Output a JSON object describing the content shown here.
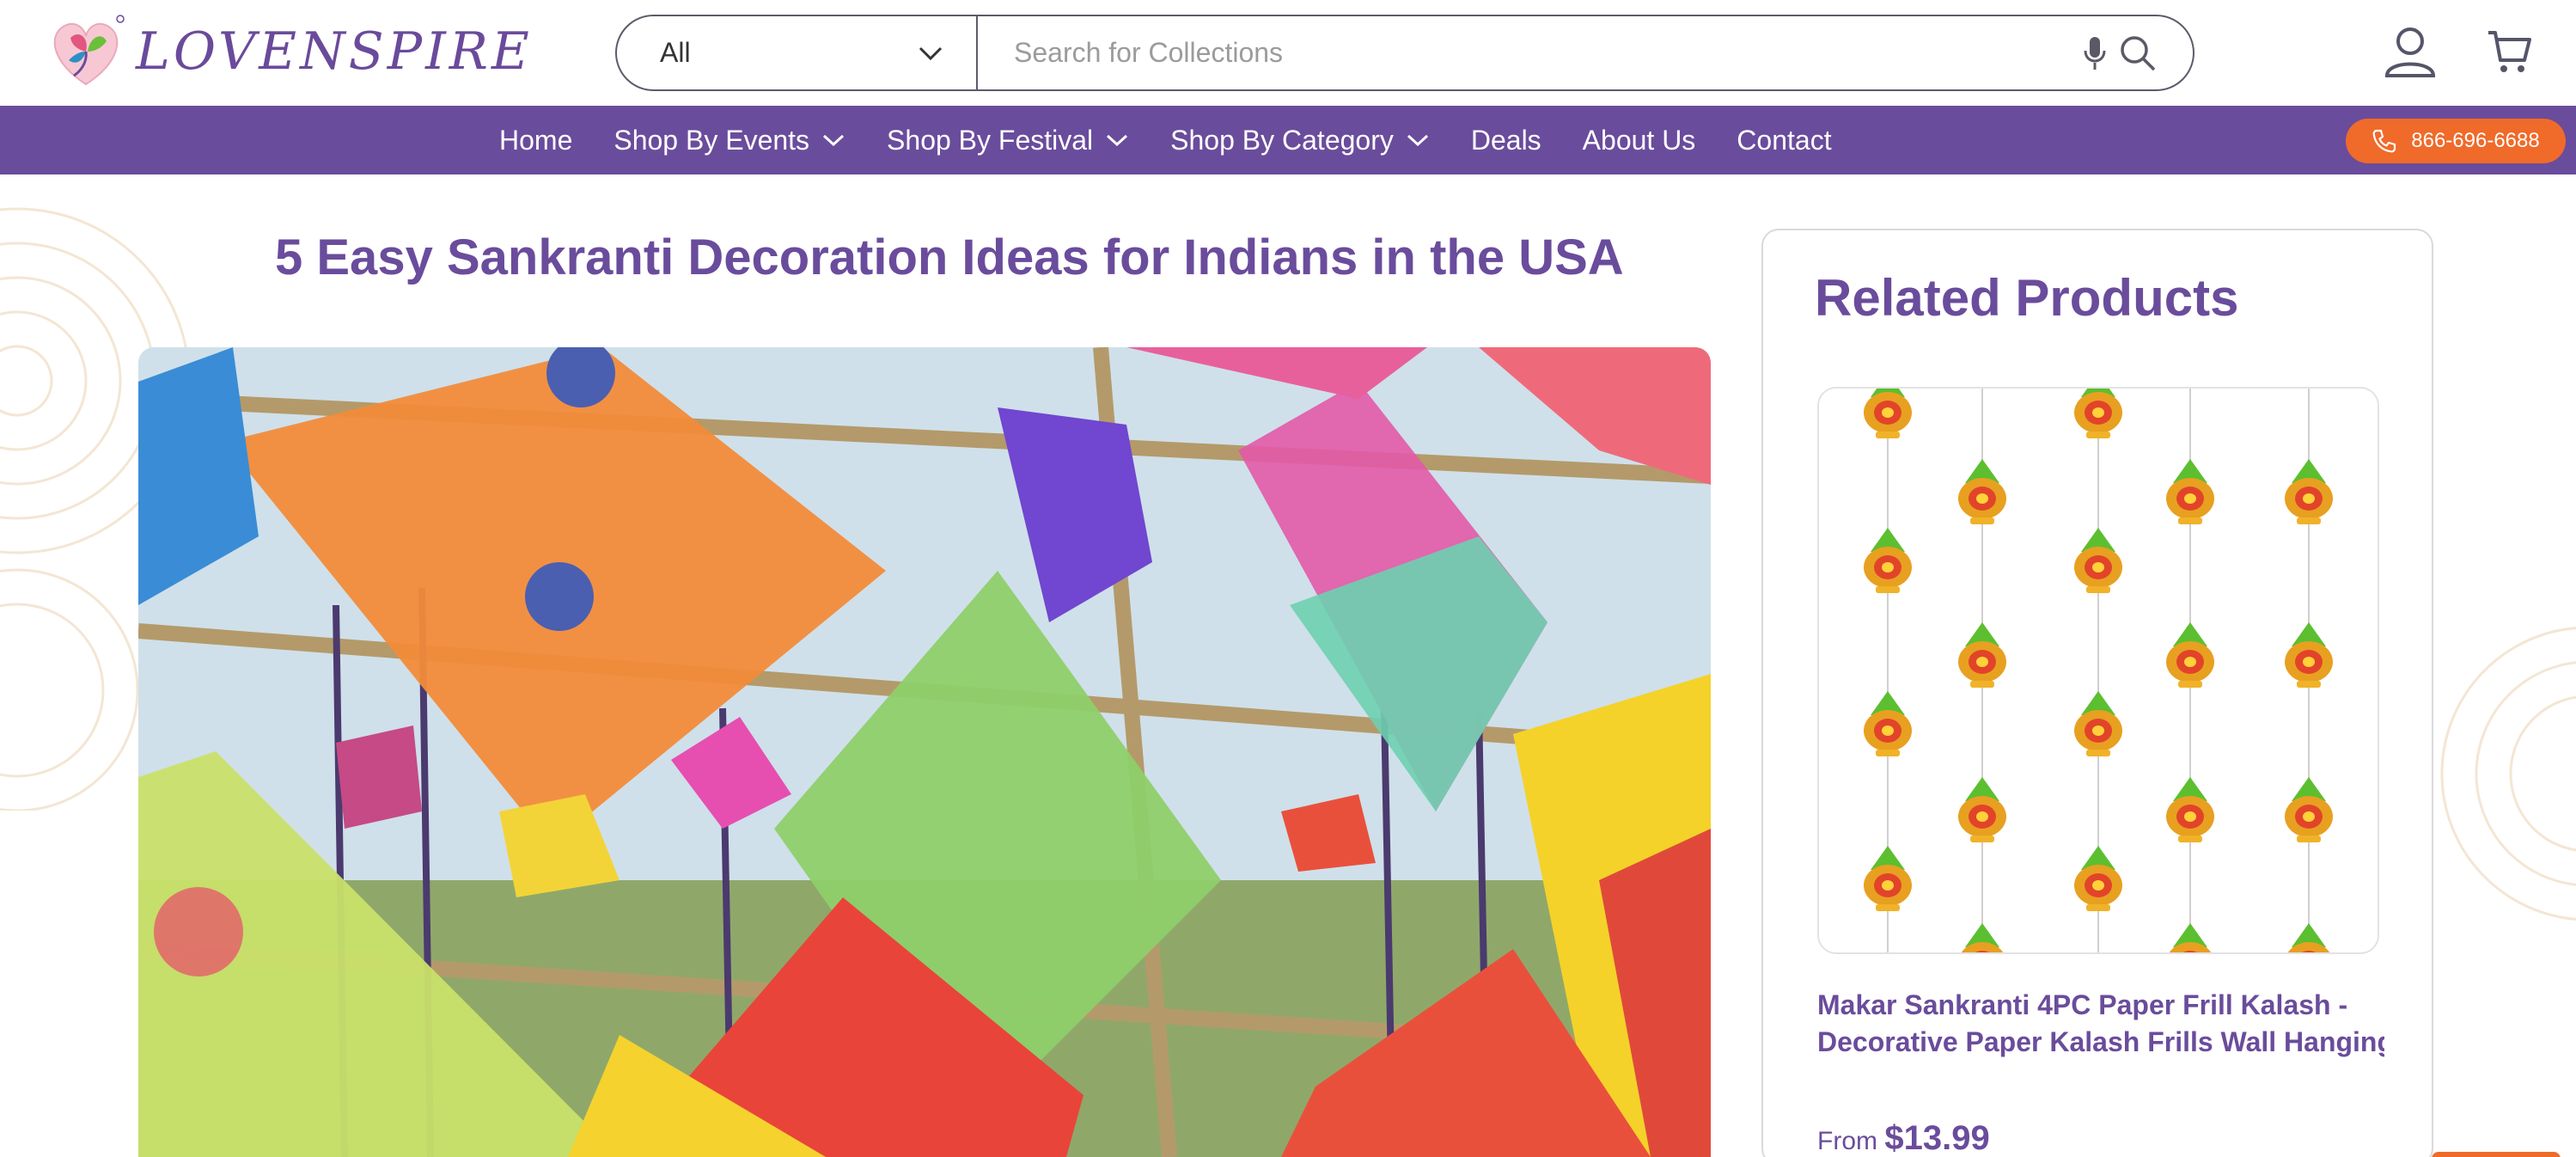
{
  "brand": {
    "name": "LOVENSPIRE",
    "color": "#6a4c9c",
    "accent": "#f06a2a"
  },
  "search": {
    "category": "All",
    "placeholder": "Search for Collections"
  },
  "header_icons": [
    "microphone-icon",
    "search-icon",
    "user-icon",
    "cart-icon"
  ],
  "nav": {
    "items": [
      {
        "label": "Home",
        "dropdown": false
      },
      {
        "label": "Shop By Events",
        "dropdown": true
      },
      {
        "label": "Shop By Festival",
        "dropdown": true
      },
      {
        "label": "Shop By Category",
        "dropdown": true
      },
      {
        "label": "Deals",
        "dropdown": false
      },
      {
        "label": "About Us",
        "dropdown": false
      },
      {
        "label": "Contact",
        "dropdown": false
      }
    ],
    "phone": "866-696-6688"
  },
  "article": {
    "title": "5 Easy Sankranti Decoration Ideas for Indians in the USA"
  },
  "related": {
    "heading": "Related Products",
    "product": {
      "name_line1": "Makar Sankranti 4PC Paper Frill Kalash -",
      "name_line2": "Decorative Paper Kalash Frills Wall Hanging...",
      "price_prefix": "From",
      "price": "$13.99"
    }
  }
}
